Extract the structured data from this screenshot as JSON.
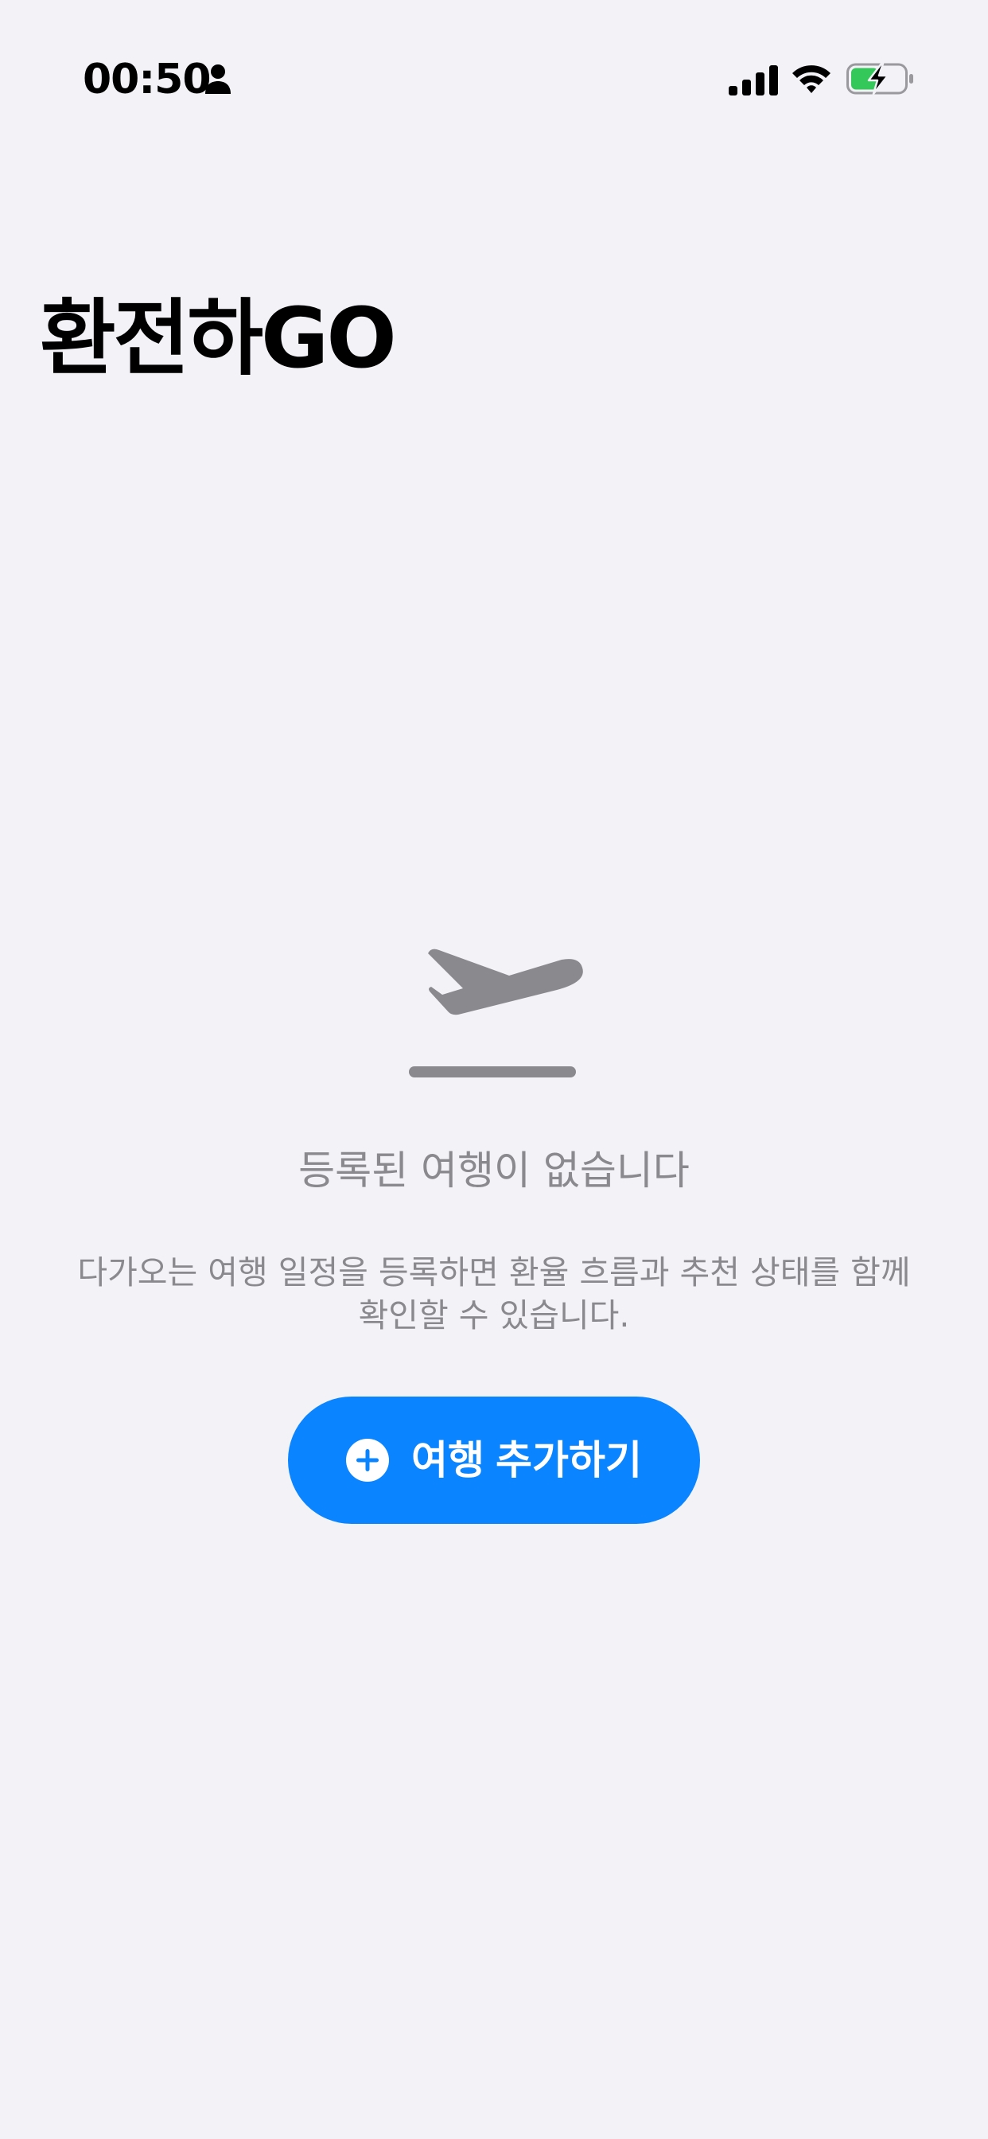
{
  "status_bar": {
    "time": "00:50",
    "person_icon": "person-fill-icon",
    "signal_icon": "cellular-signal-icon",
    "wifi_icon": "wifi-icon",
    "battery_icon": "battery-charging-icon"
  },
  "header": {
    "title": "환전하GO"
  },
  "empty_state": {
    "icon": "airplane-departure-icon",
    "heading": "등록된 여행이 없습니다",
    "description": "다가오는 여행 일정을 등록하면 환율 흐름과 추천 상태를 함께 확인할 수 있습니다.",
    "button_icon": "plus-circle-icon",
    "button_label": "여행 추가하기"
  },
  "colors": {
    "background": "#f2f2f7",
    "accent": "#0a84ff",
    "secondary_text": "#8a8a8e",
    "battery_fill": "#34c759"
  }
}
